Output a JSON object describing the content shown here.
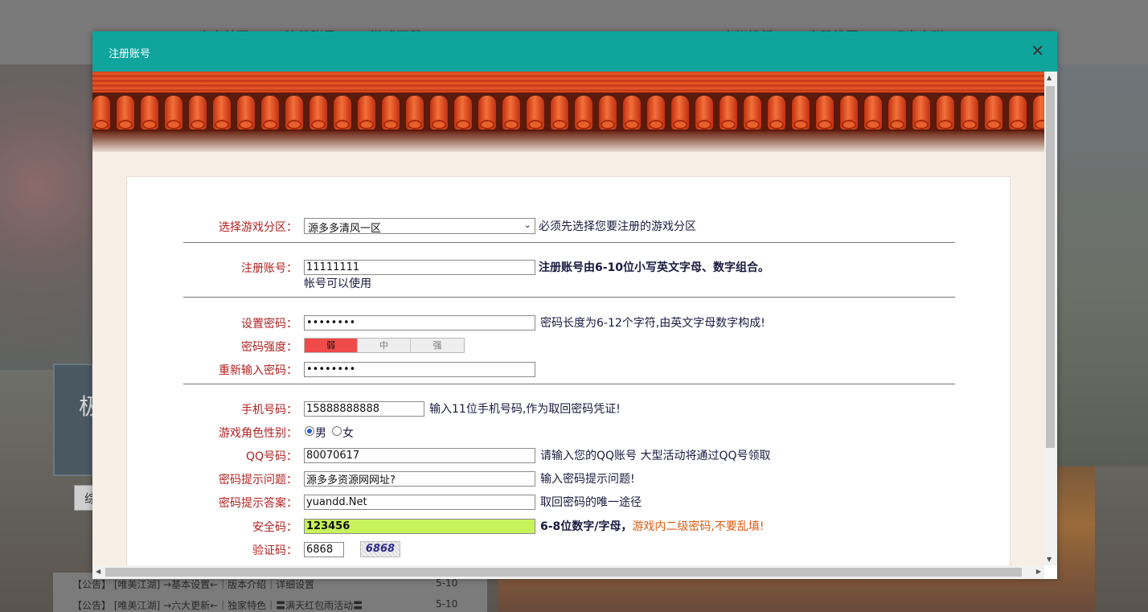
{
  "background": {
    "nav_left": [
      "官方首页",
      "注册账号",
      "游戏下载"
    ],
    "nav_right": [
      "人物排行",
      "密码找回",
      "玩家大群"
    ],
    "panel_char": "极",
    "tab_char": "综",
    "news": [
      {
        "tag": "【公告】",
        "text": "[唯美江湖] →基本设置←｜版本介绍｜详细设置",
        "date": "5-10"
      },
      {
        "tag": "【公告】",
        "text": "[唯美江湖] →六大更新←｜独家特色｜〓满天红包雨活动〓",
        "date": "5-10"
      }
    ]
  },
  "modal": {
    "title": "注册账号",
    "close": "✕"
  },
  "form": {
    "server": {
      "label": "选择游戏分区：",
      "value": "源多多清风一区",
      "hint": "必须先选择您要注册的游戏分区"
    },
    "account": {
      "label": "注册账号：",
      "value": "11111111",
      "hint": "注册账号由6-10位小写英文字母、数字组合。",
      "status": "帐号可以使用"
    },
    "password": {
      "label": "设置密码：",
      "value": "••••••••",
      "hint": "密码长度为6-12个字符,由英文字母数字构成!"
    },
    "strength": {
      "label": "密码强度：",
      "levels": [
        "弱",
        "中",
        "强"
      ]
    },
    "confirm": {
      "label": "重新输入密码：",
      "value": "••••••••"
    },
    "phone": {
      "label": "手机号码：",
      "value": "15888888888",
      "hint": "输入11位手机号码,作为取回密码凭证!"
    },
    "gender": {
      "label": "游戏角色性别：",
      "male": "男",
      "female": "女"
    },
    "qq": {
      "label": "QQ号码：",
      "value": "80070617",
      "hint": "请输入您的QQ账号 大型活动将通过QQ号领取"
    },
    "question": {
      "label": "密码提示问题：",
      "value": "源多多资源网网址?",
      "hint": "输入密码提示问题!"
    },
    "answer": {
      "label": "密码提示答案：",
      "value": "yuandd.Net",
      "hint": "取回密码的唯一途径"
    },
    "safety": {
      "label": "安全码：",
      "value": "123456",
      "hint": "6-8位数字/字母，",
      "hint_warn": "游戏内二级密码,不要乱填!"
    },
    "captcha": {
      "label": "验证码：",
      "value": "6868",
      "image_text": "6868"
    }
  },
  "colors": {
    "header": "#0fa59d",
    "label": "#b22222",
    "safety_bg": "#c8f25a",
    "strength_weak": "#f04a4a"
  }
}
